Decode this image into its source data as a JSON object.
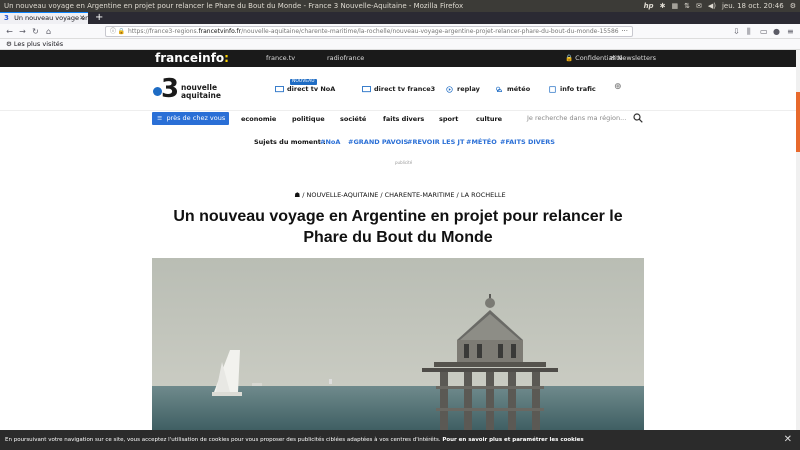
{
  "os": {
    "window_title": "Un nouveau voyage en Argentine en projet pour relancer le Phare du Bout du Monde - France 3 Nouvelle-Aquitaine - Mozilla Firefox",
    "clock": "jeu. 18 oct. 20:46"
  },
  "browser": {
    "tab_title": "Un nouveau voyage en A",
    "new_tab": "+",
    "url_prefix": "https://france3-regions.",
    "url_host": "francetvinfo.fr",
    "url_path": "/nouvelle-aquitaine/charente-maritime/la-rochelle/nouveau-voyage-argentine-projet-relancer-phare-du-bout-du-monde-15586",
    "bookmark_label": "Les plus visités"
  },
  "site_header": {
    "logo_text": "franceinfo",
    "logo_colon": ":",
    "links": [
      "france.tv",
      "radiofrance"
    ],
    "confidentialite": "Confidentialité",
    "newsletters": "Newsletters"
  },
  "brand": {
    "logo_number": "3",
    "logo_line1": "nouvelle",
    "logo_line2": "aquitaine",
    "badge_new": "NOUVEAU",
    "services": [
      "direct tv NoA",
      "direct tv france3",
      "replay",
      "météo",
      "info trafic"
    ]
  },
  "menu": {
    "region_button": "près de chez vous",
    "items": [
      "economie",
      "politique",
      "société",
      "faits divers",
      "sport",
      "culture"
    ],
    "search_placeholder": "Je recherche dans ma région..."
  },
  "topics": {
    "label": "Sujets du moment :",
    "tags": [
      "#NoA",
      "#GRAND PAVOIS",
      "#REVOIR LES JT",
      "#MÉTÉO",
      "#FAITS DIVERS"
    ]
  },
  "ad_label": "publicité",
  "breadcrumb": "/ NOUVELLE-AQUITAINE / CHARENTE-MARITIME / LA ROCHELLE",
  "article": {
    "headline": "Un nouveau voyage en Argentine en projet pour relancer le Phare du Bout du Monde"
  },
  "cookie": {
    "text": "En poursuivant votre navigation sur ce site, vous acceptez l'utilisation de cookies pour vous proposer des publicités ciblées adaptées à vos centres d'intérêts.",
    "link": "Pour en savoir plus et paramétrer les cookies",
    "close": "✕"
  }
}
